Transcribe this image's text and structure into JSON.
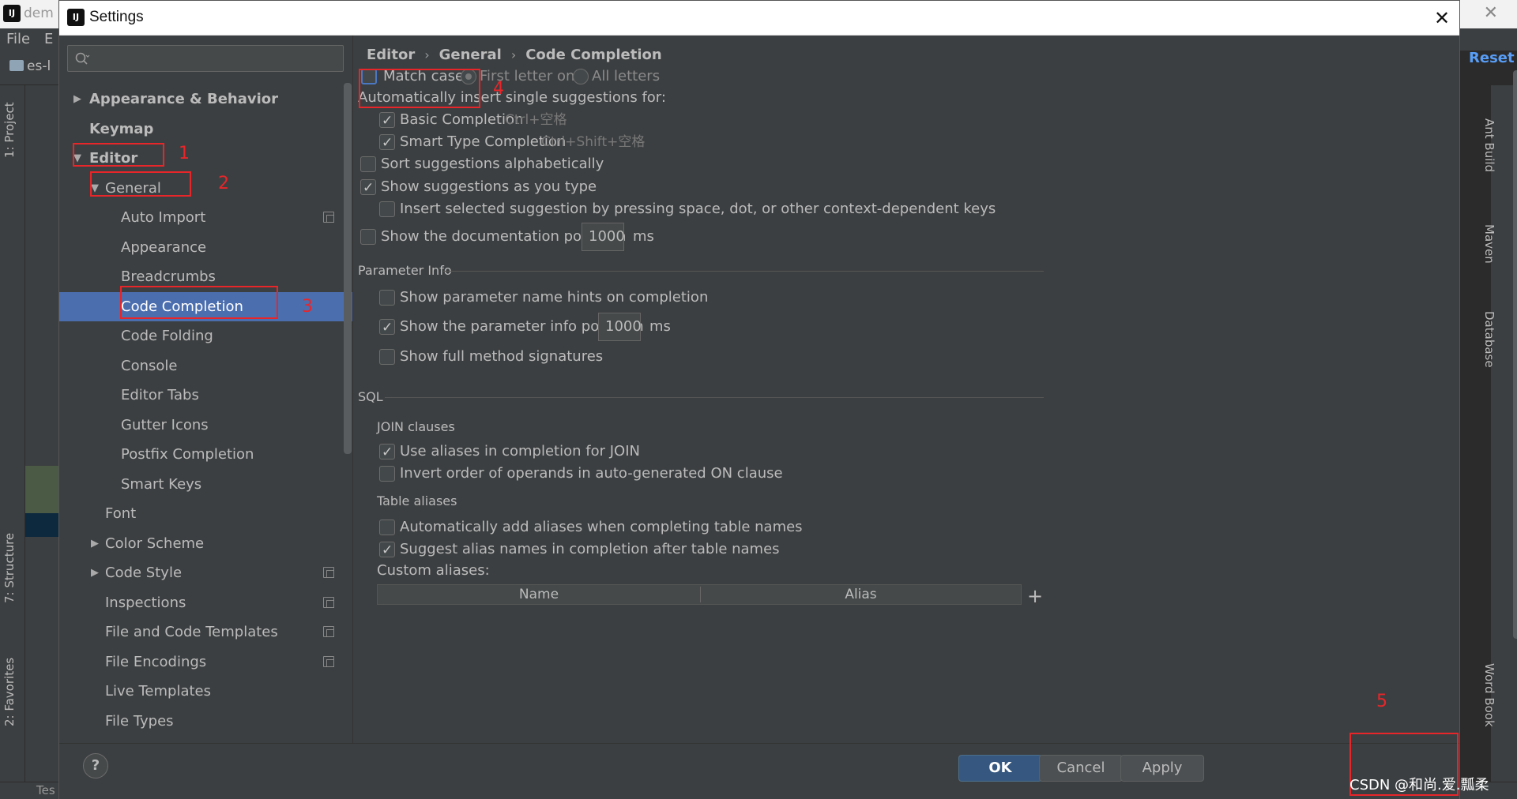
{
  "ide": {
    "app_icon": "IJ",
    "window_title": "dem",
    "menu": [
      "File",
      "E"
    ],
    "project_label": "es-l",
    "left_tabs": [
      "1: Project",
      "7: Structure",
      "2: Favorites"
    ],
    "right_tabs": [
      "Ant Build",
      "Maven",
      "Database",
      "Word Book"
    ],
    "status_text": "Tes"
  },
  "dialog": {
    "icon": "IJ",
    "title": "Settings",
    "close_icon": "close-icon",
    "search": {
      "placeholder": "",
      "value": ""
    },
    "tree": [
      {
        "label": "Appearance & Behavior",
        "level": 0,
        "arrow": "▶",
        "bold": true
      },
      {
        "label": "Keymap",
        "level": 0,
        "arrow": "",
        "bold": true
      },
      {
        "label": "Editor",
        "level": 0,
        "arrow": "▼",
        "bold": true
      },
      {
        "label": "General",
        "level": 1,
        "arrow": "▼"
      },
      {
        "label": "Auto Import",
        "level": 2,
        "copy": true
      },
      {
        "label": "Appearance",
        "level": 2
      },
      {
        "label": "Breadcrumbs",
        "level": 2
      },
      {
        "label": "Code Completion",
        "level": 2,
        "selected": true
      },
      {
        "label": "Code Folding",
        "level": 2
      },
      {
        "label": "Console",
        "level": 2
      },
      {
        "label": "Editor Tabs",
        "level": 2
      },
      {
        "label": "Gutter Icons",
        "level": 2
      },
      {
        "label": "Postfix Completion",
        "level": 2
      },
      {
        "label": "Smart Keys",
        "level": 2
      },
      {
        "label": "Font",
        "level": 1
      },
      {
        "label": "Color Scheme",
        "level": 1,
        "arrow": "▶"
      },
      {
        "label": "Code Style",
        "level": 1,
        "arrow": "▶",
        "copy": true
      },
      {
        "label": "Inspections",
        "level": 1,
        "copy": true
      },
      {
        "label": "File and Code Templates",
        "level": 1,
        "copy": true
      },
      {
        "label": "File Encodings",
        "level": 1,
        "copy": true
      },
      {
        "label": "Live Templates",
        "level": 1
      },
      {
        "label": "File Types",
        "level": 1
      }
    ],
    "breadcrumb": [
      "Editor",
      "General",
      "Code Completion"
    ],
    "breadcrumb_sep": "›",
    "reset_label": "Reset",
    "match_case": {
      "label": "Match case:",
      "checked": false
    },
    "case_options": [
      {
        "label": "First letter only",
        "checked": true
      },
      {
        "label": "All letters",
        "checked": false
      }
    ],
    "auto_insert_label": "Automatically insert single suggestions for:",
    "basic_completion": {
      "label": "Basic Completion",
      "shortcut": "Ctrl+空格",
      "checked": true
    },
    "smart_completion": {
      "label": "Smart Type Completion",
      "shortcut": "Ctrl+Shift+空格",
      "checked": true
    },
    "sort_alpha": {
      "label": "Sort suggestions alphabetically",
      "checked": false
    },
    "show_as_type": {
      "label": "Show suggestions as you type",
      "checked": true
    },
    "insert_selected": {
      "label": "Insert selected suggestion by pressing space, dot, or other context-dependent keys",
      "checked": false
    },
    "doc_popup": {
      "label": "Show the documentation popup in",
      "value": "1000",
      "unit": "ms",
      "checked": false
    },
    "param_info": {
      "title": "Parameter Info",
      "name_hints": {
        "label": "Show parameter name hints on completion",
        "checked": false
      },
      "info_popup": {
        "label": "Show the parameter info popup in",
        "value": "1000",
        "unit": "ms",
        "checked": true
      },
      "full_sig": {
        "label": "Show full method signatures",
        "checked": false
      }
    },
    "sql": {
      "title": "SQL",
      "join_title": "JOIN clauses",
      "use_aliases": {
        "label": "Use aliases in completion for JOIN",
        "checked": true
      },
      "invert_order": {
        "label": "Invert order of operands in auto-generated ON clause",
        "checked": false
      },
      "table_aliases_title": "Table aliases",
      "auto_add": {
        "label": "Automatically add aliases when completing table names",
        "checked": false
      },
      "suggest_alias": {
        "label": "Suggest alias names in completion after table names",
        "checked": true
      },
      "custom_aliases_label": "Custom aliases:",
      "table_columns": [
        "Name",
        "Alias"
      ],
      "add_icon": "+"
    },
    "buttons": {
      "help": "?",
      "ok": "OK",
      "cancel": "Cancel",
      "apply": "Apply"
    }
  },
  "annotations": [
    "1",
    "2",
    "3",
    "4",
    "5"
  ],
  "watermark": "CSDN @和尚.爱.瓢柔",
  "colors": {
    "accent": "#4b6eaf",
    "annotation": "#e8262a",
    "link": "#589df6",
    "ok_button": "#365880"
  }
}
